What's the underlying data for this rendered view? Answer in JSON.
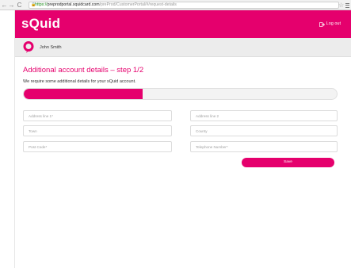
{
  "browser": {
    "url_scheme": "https://",
    "url_host": "preprodportal.squidcard.com",
    "url_path": "/preProd/CustomerPortal/#/request-details"
  },
  "header": {
    "logo": "sQuid",
    "logout_label": "Log out"
  },
  "user": {
    "name": "John Smith"
  },
  "form": {
    "title": "Additional account details – step 1/2",
    "subtitle": "We require some additional details for your sQuid account.",
    "progress_fraction": 0.38,
    "fields": {
      "address1": "Address line 1*",
      "address2": "Address line 2",
      "town": "Town",
      "county": "County",
      "postcode": "Post Code*",
      "telephone": "Telephone Number*"
    },
    "save_label": "Save"
  },
  "colors": {
    "brand": "#e5006d"
  }
}
